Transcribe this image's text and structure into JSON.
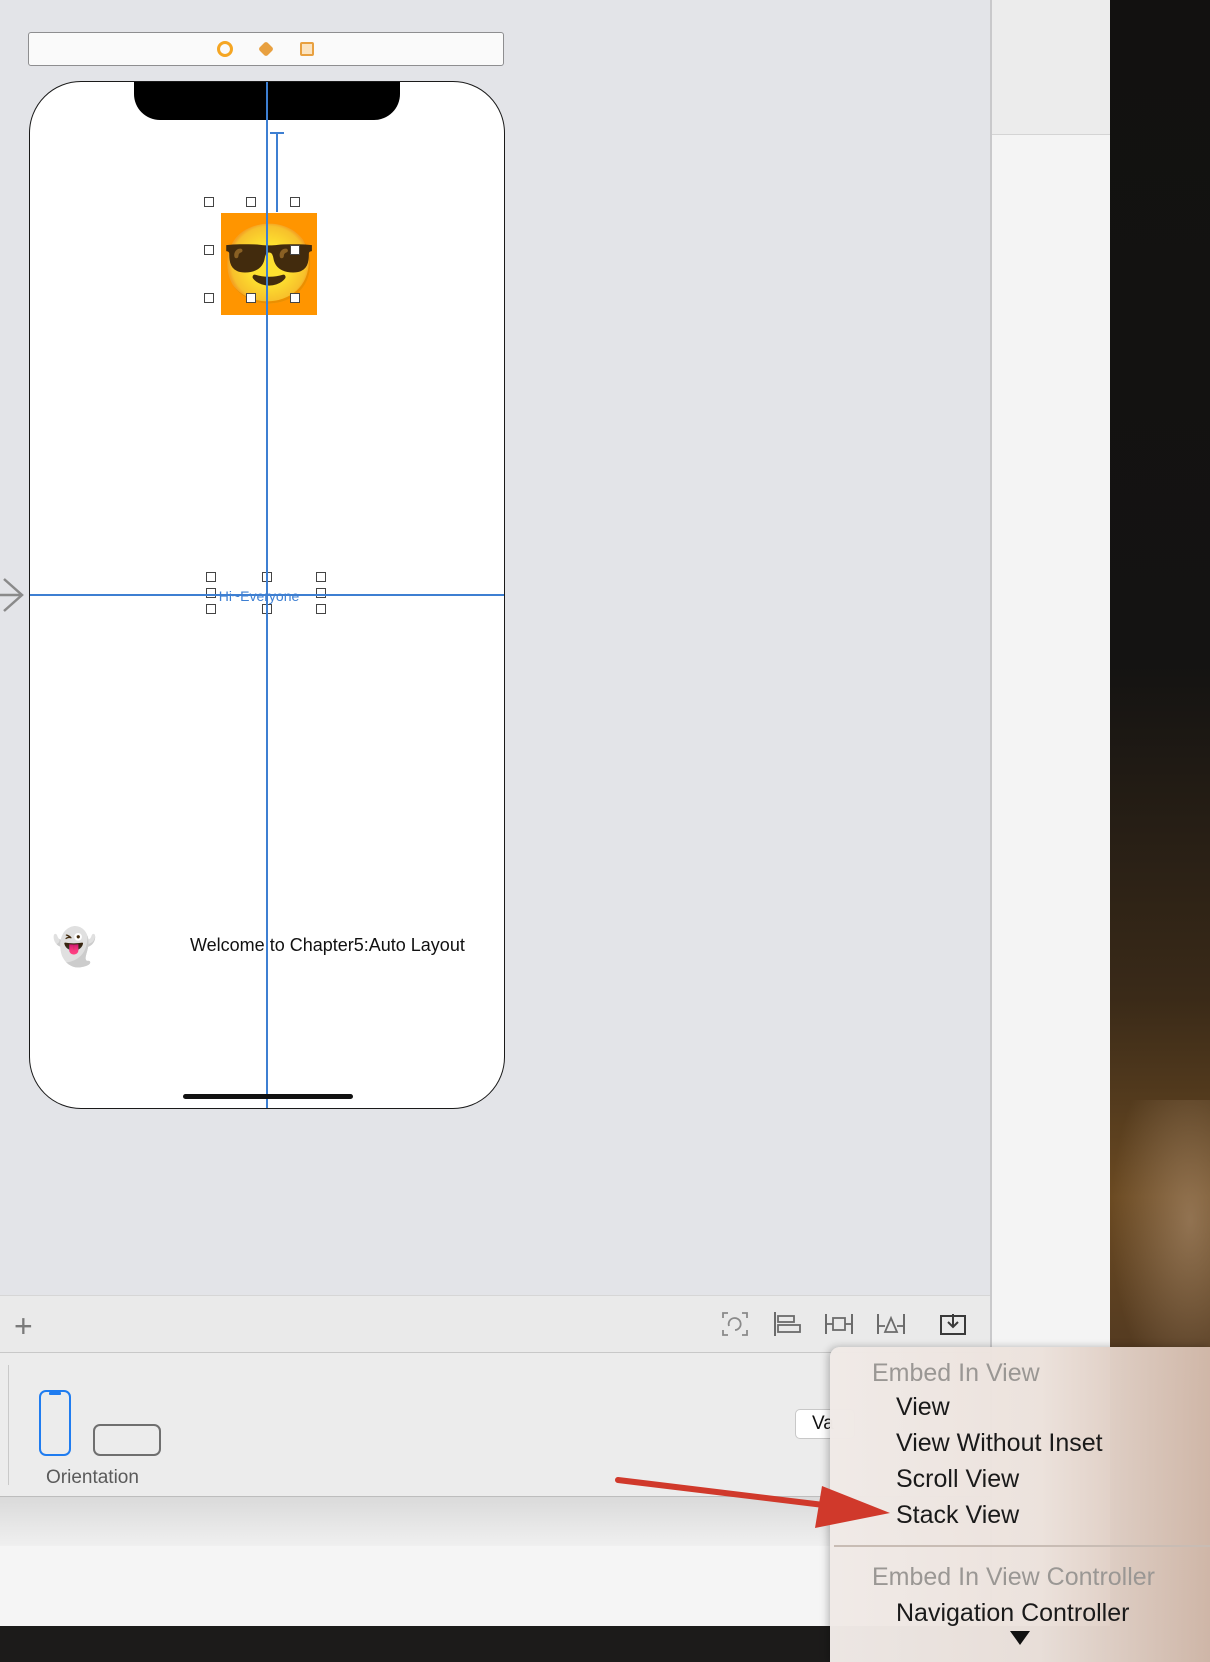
{
  "scene": {
    "dock_icons": [
      "view-controller-icon",
      "first-responder-icon",
      "exit-icon"
    ],
    "greeting_label": "Hi~Everyone",
    "welcome_label": "Welcome to Chapter5:Auto Layout",
    "image_emoji": "😎",
    "ghost_emoji": "👻",
    "image_background": "#ff9500",
    "guide_color": "#3d7fd2"
  },
  "bottom_bar": {
    "add_label": "+",
    "icons": [
      "update-frames-icon",
      "align-icon",
      "add-constraints-icon",
      "resolve-autolayout-icon",
      "embed-in-icon"
    ]
  },
  "device_config": {
    "orientation_label": "Orientation",
    "selected_orientation": "portrait",
    "variation_button_label": "Va"
  },
  "embed_menu": {
    "section1_header": "Embed In View",
    "section1_items": [
      "View",
      "View Without Inset",
      "Scroll View",
      "Stack View"
    ],
    "section2_header": "Embed In View Controller",
    "section2_items": [
      "Navigation Controller"
    ],
    "highlighted_item": "Stack View",
    "annotation_color": "#d0392b"
  }
}
